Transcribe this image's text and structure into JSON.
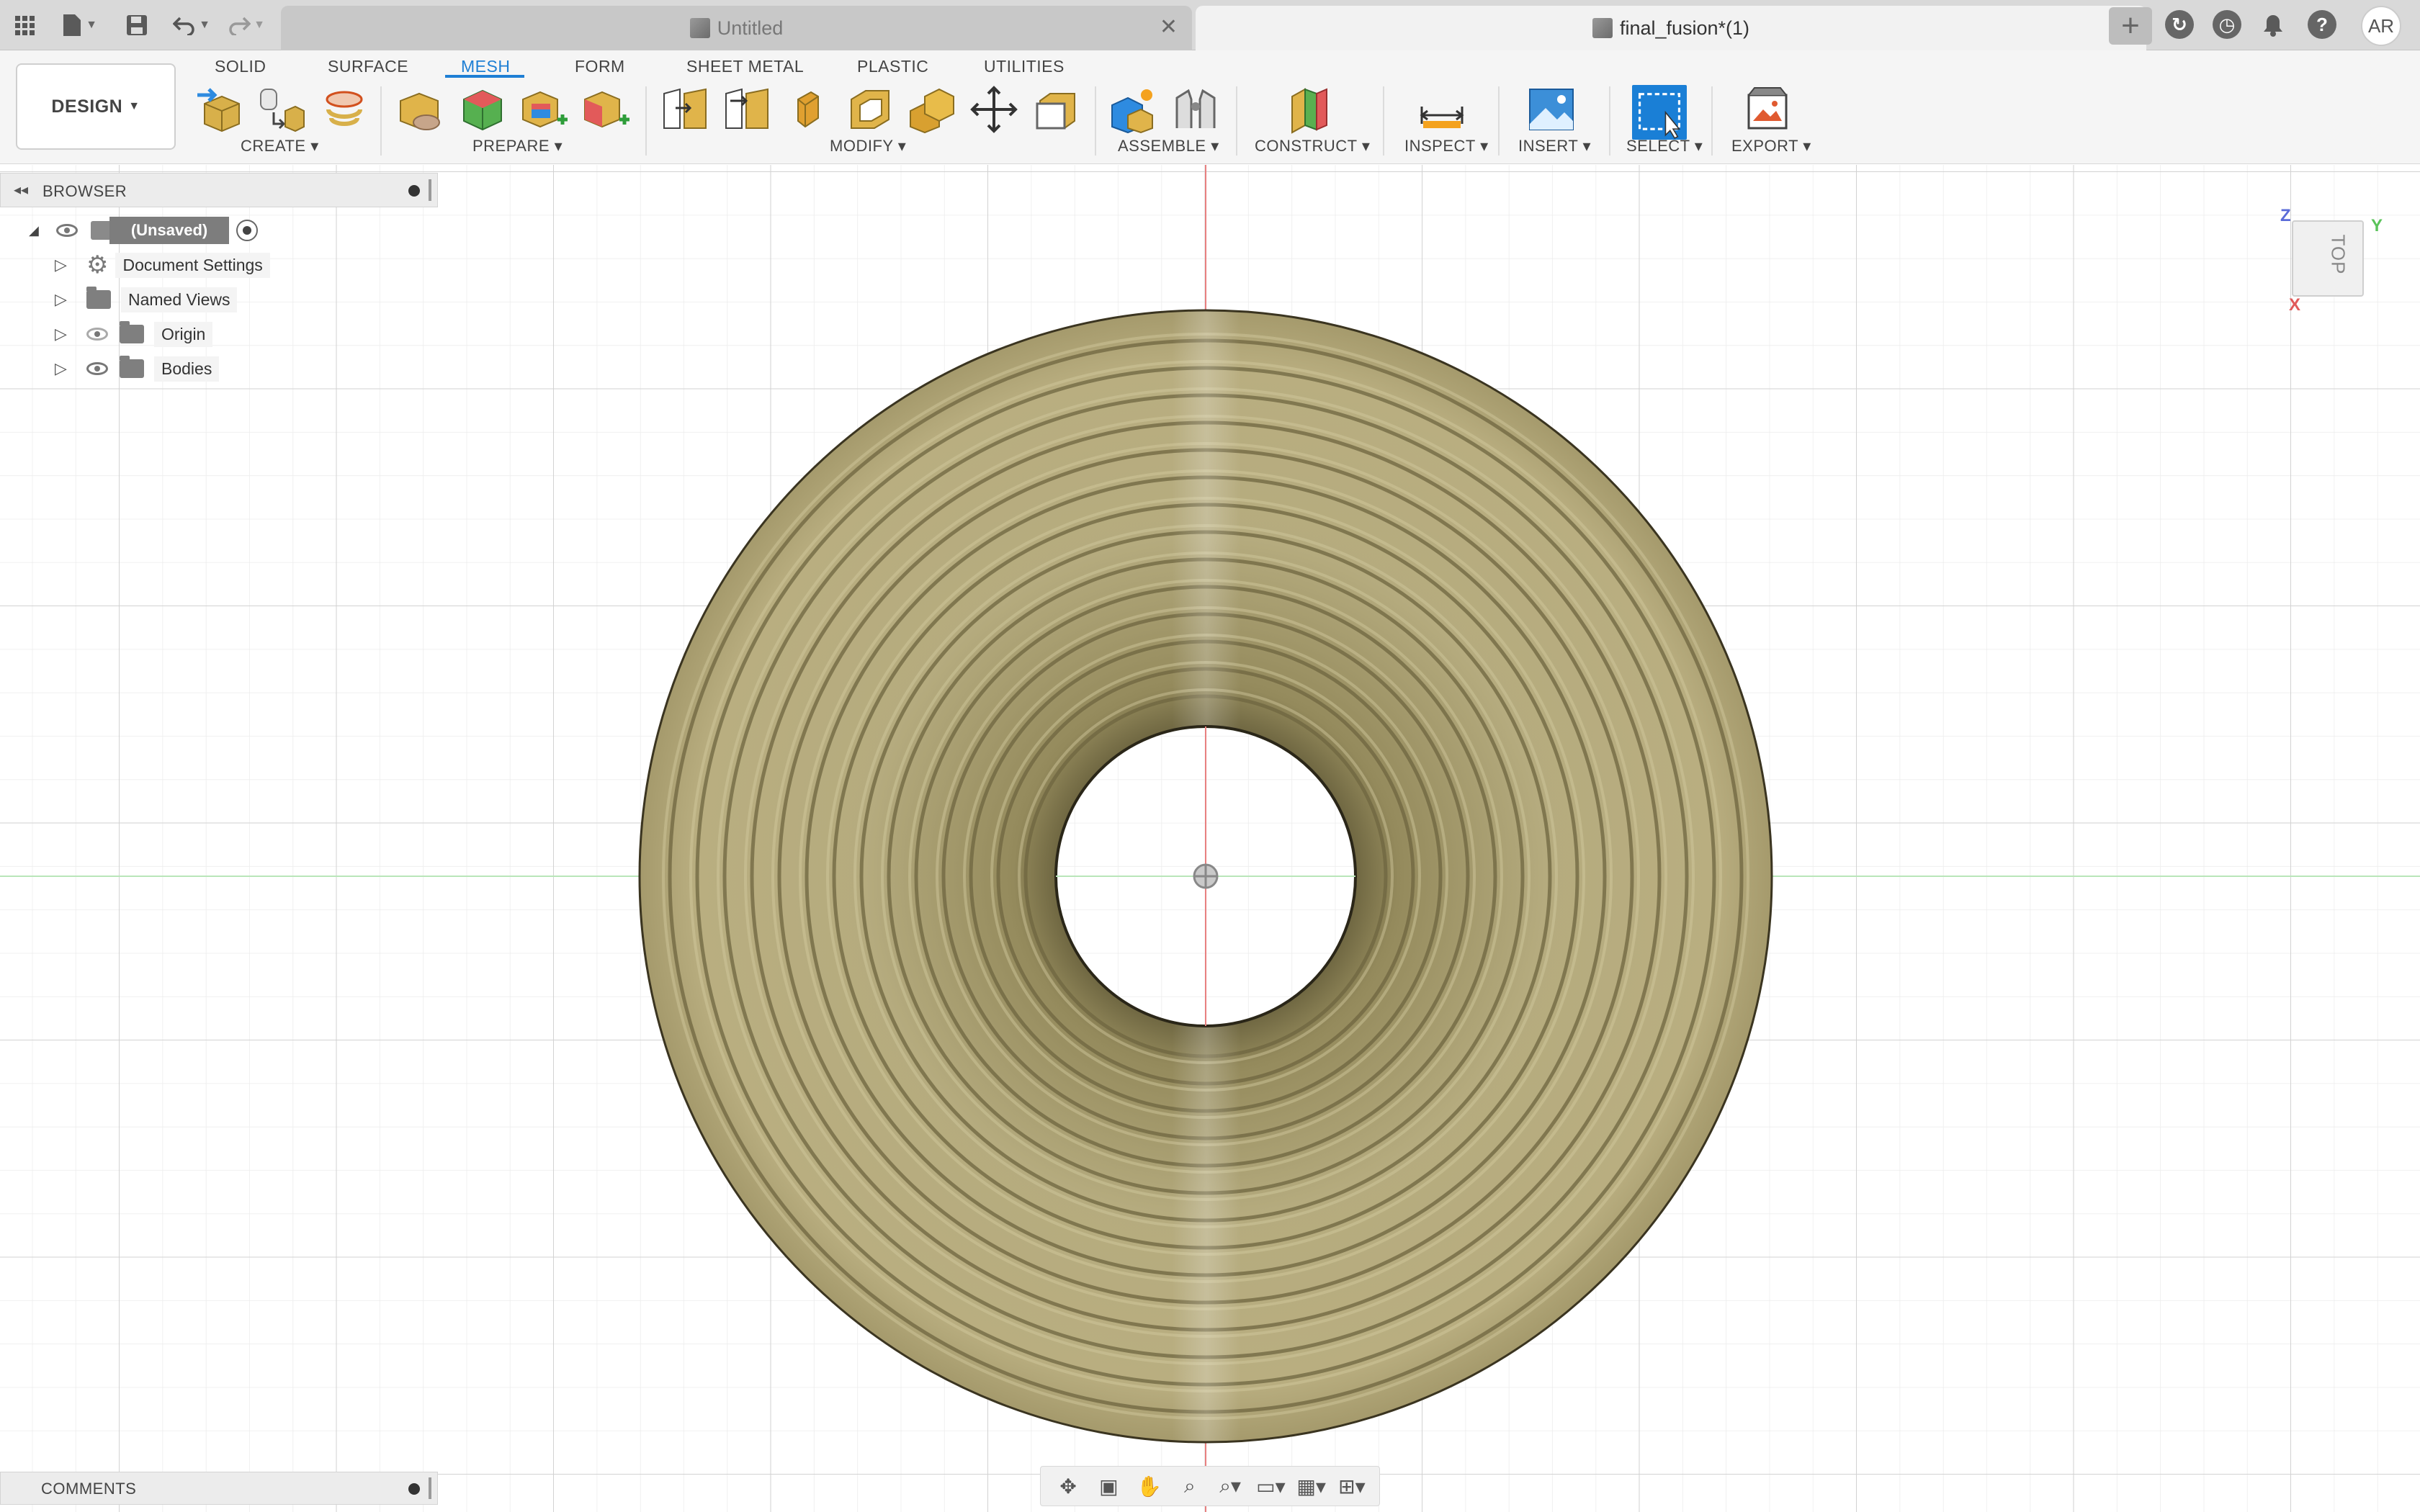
{
  "window": {
    "tabs": [
      {
        "label": "Untitled",
        "active": false
      },
      {
        "label": "final_fusion*(1)",
        "active": true
      }
    ],
    "user_initials": "AR"
  },
  "toolbar": {
    "workspace_button": "DESIGN",
    "workspace_tabs": [
      "SOLID",
      "SURFACE",
      "MESH",
      "FORM",
      "SHEET METAL",
      "PLASTIC",
      "UTILITIES"
    ],
    "active_tab": "MESH",
    "groups": [
      "CREATE",
      "PREPARE",
      "MODIFY",
      "ASSEMBLE",
      "CONSTRUCT",
      "INSPECT",
      "INSERT",
      "SELECT",
      "EXPORT"
    ]
  },
  "browser": {
    "title": "BROWSER",
    "root": "(Unsaved)",
    "items": [
      "Document Settings",
      "Named Views",
      "Origin",
      "Bodies"
    ]
  },
  "comments": {
    "title": "COMMENTS"
  },
  "viewcube": {
    "face": "TOP",
    "axes": {
      "z": "Z",
      "y": "Y",
      "x": "X"
    }
  },
  "colors": {
    "accent": "#1e7fd4",
    "model": "#b2a77a",
    "model_ridge": "#8e8457",
    "x_axis": "#e05a5a",
    "y_axis": "#5ac35a",
    "z_axis": "#5a6bd8"
  }
}
